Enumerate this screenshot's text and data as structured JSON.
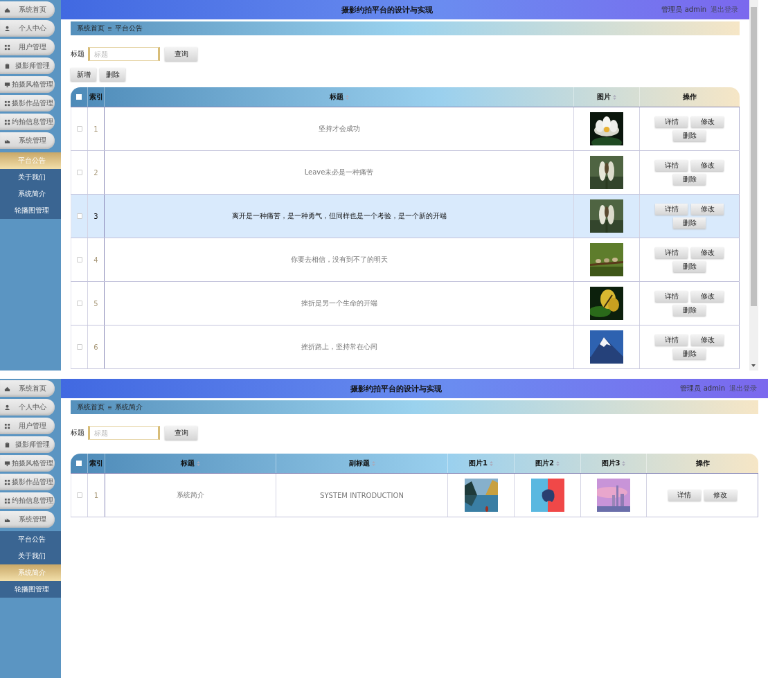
{
  "screens": [
    {
      "app_title": "摄影约拍平台的设计与实现",
      "user": "管理员 admin",
      "logout": "退出登录",
      "menu": [
        {
          "label": "系统首页"
        },
        {
          "label": "个人中心"
        },
        {
          "label": "用户管理"
        },
        {
          "label": "摄影师管理"
        },
        {
          "label": "拍摄风格管理"
        },
        {
          "label": "摄影作品管理"
        },
        {
          "label": "约拍信息管理"
        },
        {
          "label": "系统管理"
        }
      ],
      "submenu": [
        {
          "label": "平台公告",
          "selected": true
        },
        {
          "label": "关于我们",
          "selected": false
        },
        {
          "label": "系统简介",
          "selected": false
        },
        {
          "label": "轮播图管理",
          "selected": false
        }
      ],
      "breadcrumb": [
        "系统首页",
        "平台公告"
      ],
      "search": {
        "label": "标题",
        "placeholder": "标题",
        "button": "查询"
      },
      "toolbar": [
        "新增",
        "删除"
      ],
      "table": {
        "header_checked": false,
        "columns": [
          {
            "label": "索引",
            "kind": "index",
            "sortable": false
          },
          {
            "label": "标题",
            "kind": "text",
            "sortable": true
          },
          {
            "label": "图片",
            "kind": "picture",
            "sortable": true
          },
          {
            "label": "操作",
            "kind": "actions",
            "sortable": false
          }
        ],
        "rows": [
          {
            "selected": false,
            "checked": false,
            "cells": [
              "1",
              "坚持才会成功",
              {
                "kind": "picture"
              }
            ],
            "actions": [
              "详情",
              "修改",
              "删除"
            ]
          },
          {
            "selected": false,
            "checked": false,
            "cells": [
              "2",
              "Leave未必是一种痛苦",
              {
                "kind": "picture"
              }
            ],
            "actions": [
              "详情",
              "修改",
              "删除"
            ]
          },
          {
            "selected": true,
            "checked": false,
            "cells": [
              "3",
              "离开是一种痛苦，是一种勇气，但同样也是一个考验，是一个新的开端",
              {
                "kind": "picture"
              }
            ],
            "actions": [
              "详情",
              "修改",
              "删除"
            ]
          },
          {
            "selected": false,
            "checked": false,
            "cells": [
              "4",
              "你要去相信，没有到不了的明天",
              {
                "kind": "picture"
              }
            ],
            "actions": [
              "详情",
              "修改",
              "删除"
            ]
          },
          {
            "selected": false,
            "checked": false,
            "cells": [
              "5",
              "挫折是另一个生命的开端",
              {
                "kind": "picture"
              }
            ],
            "actions": [
              "详情",
              "修改",
              "删除"
            ]
          },
          {
            "selected": false,
            "checked": false,
            "cells": [
              "6",
              "挫折路上，坚持常在心间",
              {
                "kind": "picture"
              }
            ],
            "actions": [
              "详情",
              "修改",
              "删除"
            ]
          }
        ]
      }
    },
    {
      "app_title": "摄影约拍平台的设计与实现",
      "user": "管理员 admin",
      "logout": "退出登录",
      "menu": [
        {
          "label": "系统首页"
        },
        {
          "label": "个人中心"
        },
        {
          "label": "用户管理"
        },
        {
          "label": "摄影师管理"
        },
        {
          "label": "拍摄风格管理"
        },
        {
          "label": "摄影作品管理"
        },
        {
          "label": "约拍信息管理"
        },
        {
          "label": "系统管理"
        }
      ],
      "submenu": [
        {
          "label": "平台公告",
          "selected": false
        },
        {
          "label": "关于我们",
          "selected": false
        },
        {
          "label": "系统简介",
          "selected": true
        },
        {
          "label": "轮播图管理",
          "selected": false
        }
      ],
      "breadcrumb": [
        "系统首页",
        "系统简介"
      ],
      "search": {
        "label": "标题",
        "placeholder": "标题",
        "button": "查询"
      },
      "table": {
        "header_checked": false,
        "columns": [
          {
            "label": "索引",
            "kind": "index",
            "sortable": false
          },
          {
            "label": "标题",
            "kind": "text",
            "sortable": true
          },
          {
            "label": "副标题",
            "kind": "text",
            "sortable": true
          },
          {
            "label": "图片1",
            "kind": "picture",
            "sortable": true
          },
          {
            "label": "图片2",
            "kind": "picture",
            "sortable": true
          },
          {
            "label": "图片3",
            "kind": "picture",
            "sortable": true
          },
          {
            "label": "操作",
            "kind": "actions",
            "sortable": false
          }
        ],
        "rows": [
          {
            "selected": false,
            "checked": false,
            "cells": [
              "1",
              "系统简介",
              "SYSTEM INTRODUCTION",
              {
                "kind": "picture"
              },
              {
                "kind": "picture"
              },
              {
                "kind": "picture"
              }
            ],
            "actions": [
              "详情",
              "修改"
            ]
          }
        ]
      }
    }
  ]
}
